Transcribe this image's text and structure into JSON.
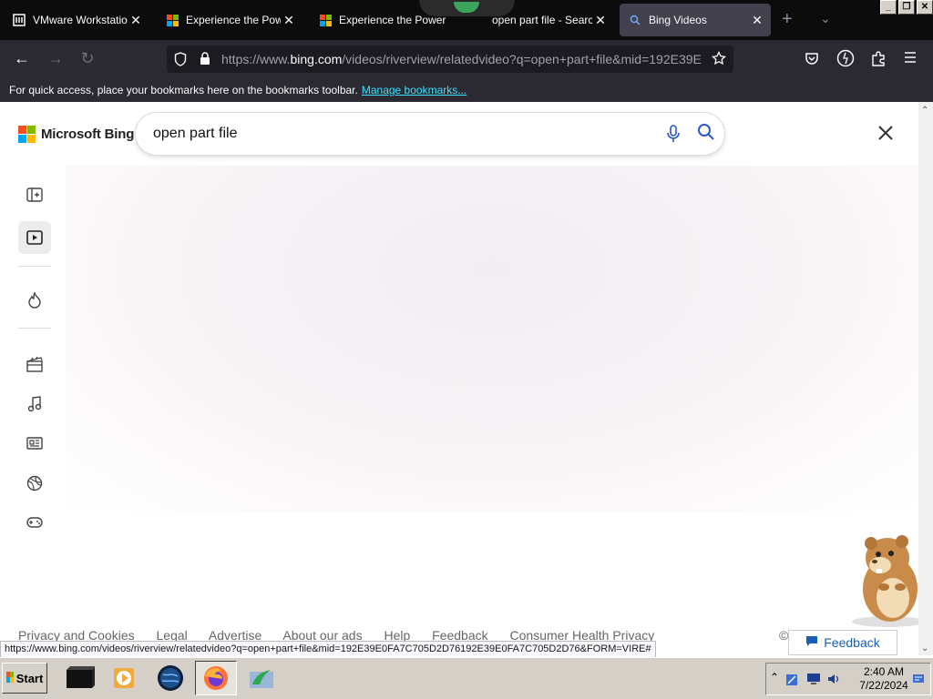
{
  "browser": {
    "tabs": [
      {
        "title": "VMware Workstation",
        "icon": "vmware-icon"
      },
      {
        "title": "Experience the Power",
        "icon": "microsoft-icon"
      },
      {
        "title": "Experience the Power",
        "icon": "microsoft-icon"
      },
      {
        "title": "open part file - Search",
        "icon": "microsoft-icon"
      },
      {
        "title": "Bing Videos",
        "icon": "search-icon",
        "active": true
      }
    ],
    "url_prefix": "https://www.",
    "url_domain": "bing.com",
    "url_rest": "/videos/riverview/relatedvideo?q=open+part+file&mid=192E39E",
    "bookmarks_text": "For quick access, place your bookmarks here on the bookmarks toolbar.",
    "bookmarks_link": "Manage bookmarks..."
  },
  "page": {
    "logo_text": "Microsoft Bing",
    "search_query": "open part file",
    "sidebar_icons": [
      "add-tab-icon",
      "video-icon",
      "trending-icon",
      "movies-icon",
      "music-icon",
      "news-icon",
      "sports-icon",
      "gaming-icon"
    ],
    "footer_links": [
      "Privacy and Cookies",
      "Legal",
      "Advertise",
      "About our ads",
      "Help",
      "Feedback",
      "Consumer Health Privacy"
    ],
    "footer_copyright": "©",
    "feedback_button": "Feedback",
    "status_url": "https://www.bing.com/videos/riverview/relatedvideo?q=open+part+file&mid=192E39E0FA7C705D2D76192E39E0FA7C705D2D76&FORM=VIRE#"
  },
  "taskbar": {
    "start_label": "Start",
    "time": "2:40 AM",
    "date": "7/22/2024"
  },
  "colors": {
    "ms_red": "#f25022",
    "ms_green": "#7fba00",
    "ms_blue": "#00a4ef",
    "ms_yellow": "#ffb900"
  }
}
